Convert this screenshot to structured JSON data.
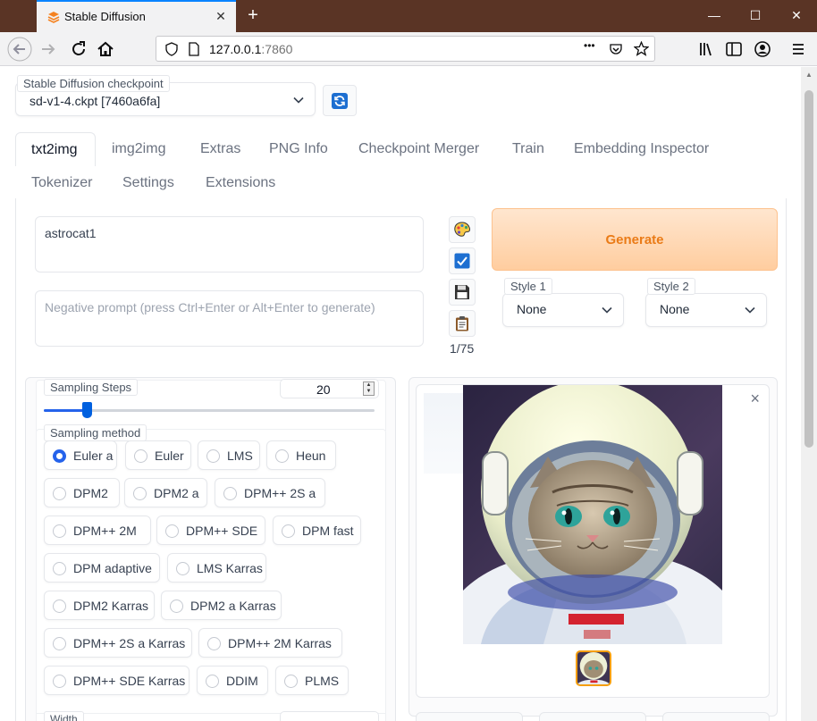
{
  "browser": {
    "tab_title": "Stable Diffusion",
    "url_host": "127.0.0.1",
    "url_port": ":7860",
    "new_tab_symbol": "+",
    "close_symbol": "✕",
    "window_buttons": [
      "—",
      "☐",
      "✕"
    ],
    "icons": [
      "back-icon",
      "forward-icon",
      "reload-icon",
      "home-icon",
      "shield-icon",
      "page-info-icon",
      "more-actions-icon",
      "pocket-icon",
      "bookmark-star-icon",
      "library-icon",
      "sidebar-icon",
      "account-icon",
      "menu-icon"
    ],
    "more_symbol": "•••"
  },
  "checkpoint": {
    "label": "Stable Diffusion checkpoint",
    "value": "sd-v1-4.ckpt [7460a6fa]",
    "refresh_icon": "refresh-icon"
  },
  "tabs": {
    "row1": [
      "txt2img",
      "img2img",
      "Extras",
      "PNG Info",
      "Checkpoint Merger",
      "Train",
      "Embedding Inspector"
    ],
    "row2": [
      "Tokenizer",
      "Settings",
      "Extensions"
    ],
    "active": "txt2img"
  },
  "prompt": {
    "value": "astrocat1",
    "negative_placeholder": "Negative prompt (press Ctrl+Enter or Alt+Enter to generate)",
    "token_count": "1/75"
  },
  "tools": [
    "palette-icon",
    "checkbox-icon",
    "save-icon",
    "clipboard-icon"
  ],
  "generate_label": "Generate",
  "styles": [
    {
      "label": "Style 1",
      "value": "None"
    },
    {
      "label": "Style 2",
      "value": "None"
    }
  ],
  "sampling_steps": {
    "label": "Sampling Steps",
    "value": "20",
    "fraction": 0.13
  },
  "sampling_method": {
    "label": "Sampling method",
    "selected": "Euler a",
    "options": [
      "Euler a",
      "Euler",
      "LMS",
      "Heun",
      "DPM2",
      "DPM2 a",
      "DPM++ 2S a",
      "DPM++ 2M",
      "DPM++ SDE",
      "DPM fast",
      "DPM adaptive",
      "LMS Karras",
      "DPM2 Karras",
      "DPM2 a Karras",
      "DPM++ 2S a Karras",
      "DPM++ 2M Karras",
      "DPM++ SDE Karras",
      "DDIM",
      "PLMS"
    ]
  },
  "width_label": "Width",
  "gallery": {
    "close_symbol": "×",
    "image": "astronaut-cat-image",
    "thumbnail": "astronaut-cat-thumbnail"
  },
  "colors": {
    "accent": "#ea7b17",
    "generate_bg": "#ffcd9f",
    "radio_selected": "#2563eb",
    "slider": "#0060df",
    "titlebar": "#5a3425"
  }
}
